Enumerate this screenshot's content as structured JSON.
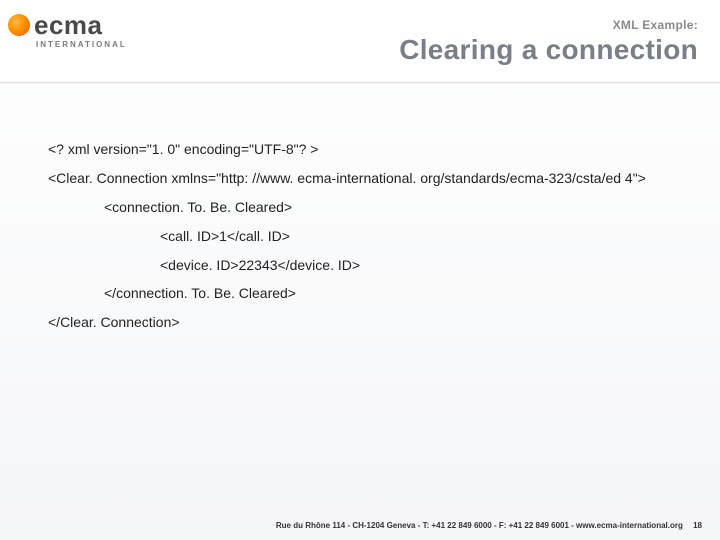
{
  "logo": {
    "main": "ecma",
    "sub": "INTERNATIONAL"
  },
  "header": {
    "subtitle": "XML Example:",
    "title": "Clearing a connection"
  },
  "xml": {
    "line1": "<? xml version=\"1. 0\" encoding=\"UTF-8\"? >",
    "line2": "<Clear. Connection xmlns=\"http: //www. ecma-international. org/standards/ecma-323/csta/ed 4\">",
    "line3": "<connection. To. Be. Cleared>",
    "line4": "<call. ID>1</call. ID>",
    "line5": "<device. ID>22343</device. ID>",
    "line6": "</connection. To. Be. Cleared>",
    "line7": "</Clear. Connection>"
  },
  "footer": {
    "text": "Rue du Rhône 114 - CH-1204 Geneva - T: +41 22 849 6000 - F: +41 22 849 6001 - www.ecma-international.org",
    "page": "18"
  }
}
